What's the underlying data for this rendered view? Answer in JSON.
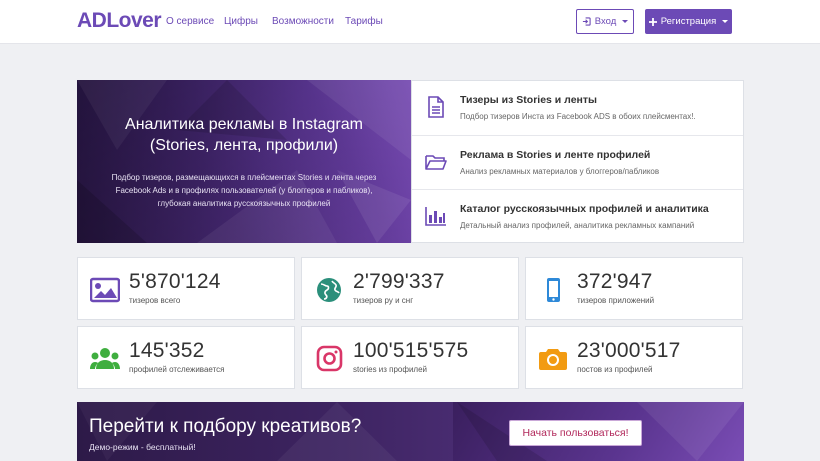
{
  "header": {
    "logo": "ADLover",
    "nav": [
      "О сервисе",
      "Цифры",
      "Возможности",
      "Тарифы"
    ],
    "login_label": "Вход",
    "register_label": "Регистрация"
  },
  "hero": {
    "title": "Аналитика рекламы в Instagram (Stories, лента, профили)",
    "description": "Подбор тизеров, размещающихся в плейсментах Stories и лента через Facebook Ads и в профилях пользователей (у блоггеров и пабликов), глубокая аналитика русскоязычных профилей"
  },
  "features": [
    {
      "icon": "document-icon",
      "title": "Тизеры из Stories и ленты",
      "desc": "Подбор тизеров Инста из Facebook ADS в обоих плейсментах!."
    },
    {
      "icon": "folder-open-icon",
      "title": "Реклама в Stories и ленте профилей",
      "desc": "Анализ рекламных материалов у блоггеров/пабликов"
    },
    {
      "icon": "bar-chart-icon",
      "title": "Каталог русскоязычных профилей и аналитика",
      "desc": "Детальный анализ профилей, аналитика рекламных кампаний"
    }
  ],
  "stats": [
    {
      "icon": "image-icon",
      "value": "5'870'124",
      "label": "тизеров всего",
      "color": "#6c4ab6"
    },
    {
      "icon": "globe-icon",
      "value": "2'799'337",
      "label": "тизеров ру и снг",
      "color": "#2b8f7b"
    },
    {
      "icon": "mobile-icon",
      "value": "372'947",
      "label": "тизеров приложений",
      "color": "#2e89d8"
    },
    {
      "icon": "users-icon",
      "value": "145'352",
      "label": "профилей отслеживается",
      "color": "#3fae3f"
    },
    {
      "icon": "instagram-icon",
      "value": "100'515'575",
      "label": "stories из профилей",
      "color": "#d93668"
    },
    {
      "icon": "camera-icon",
      "value": "23'000'517",
      "label": "постов из профилей",
      "color": "#f29b12"
    }
  ],
  "cta": {
    "title": "Перейти к подбору креативов?",
    "subtitle": "Демо-режим - бесплатный!",
    "button": "Начать пользоваться!"
  },
  "colors": {
    "brand": "#6c4ab6",
    "cta_button_text": "#b1275a"
  }
}
